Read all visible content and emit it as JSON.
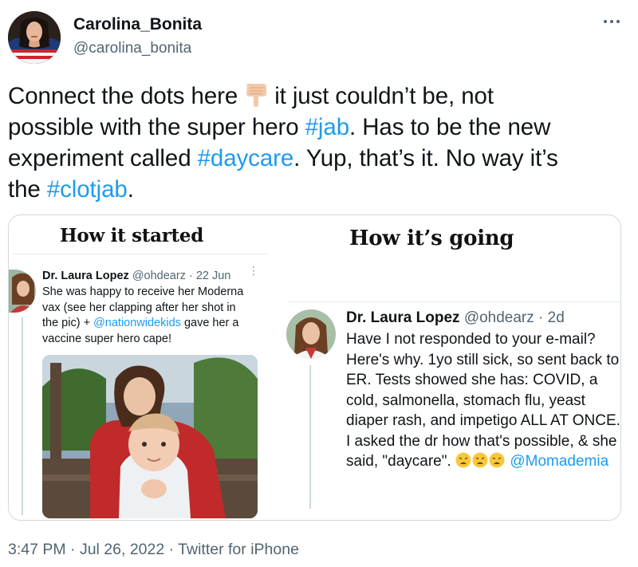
{
  "user": {
    "display_name": "Carolina_Bonita",
    "handle": "@carolina_bonita"
  },
  "tweet": {
    "text_1": "Connect the dots here",
    "text_2": "it just couldn’t be, not",
    "text_3": "possible with the super hero ",
    "tag_jab": "#jab",
    "text_4": ". Has to be the new",
    "text_5": "experiment called ",
    "tag_daycare": "#daycare",
    "text_6": ". Yup, that’s it. No way it’s",
    "text_7": "the ",
    "tag_clotjab": "#clotjab",
    "text_8": ".",
    "emoji": "backhand-index-pointing-down-icon"
  },
  "media": {
    "caption_left": "How it started",
    "caption_right": "How it’s going",
    "left_tweet": {
      "name": "Dr. Laura Lopez",
      "handle_date": "@ohdearz · 22 Jun",
      "more": "⋮",
      "line_1": "She was happy to receive her Moderna",
      "line_2": "vax (see her clapping after her shot in",
      "line_3a": "the pic) + ",
      "line_3_link": "@nationwidekids",
      "line_3b": " gave her a",
      "line_4": "vaccine super hero cape!"
    },
    "right_tweet": {
      "name": "Dr. Laura Lopez",
      "handle_date": "@ohdearz · 2d",
      "line_1": "Have I not responded to your e-mail?",
      "line_2": "Here's why. 1yo still sick, so sent back to",
      "line_3": "ER. Tests showed she has: COVID, a",
      "line_4": "cold, salmonella, stomach flu, yeast",
      "line_5": "diaper rash, and impetigo ALL AT ONCE.",
      "line_6": "I asked the dr how that's possible, & she",
      "line_7a": "said, \"daycare\". ",
      "line_7_link": "@Momademia",
      "emoji": "weary-face-icon"
    }
  },
  "footer": {
    "meta": "3:47 PM · Jul 26, 2022 · Twitter for iPhone"
  },
  "colors": {
    "link": "#1d9bf0",
    "text": "#0f1419",
    "muted": "#536471",
    "border": "#cfd9de"
  }
}
